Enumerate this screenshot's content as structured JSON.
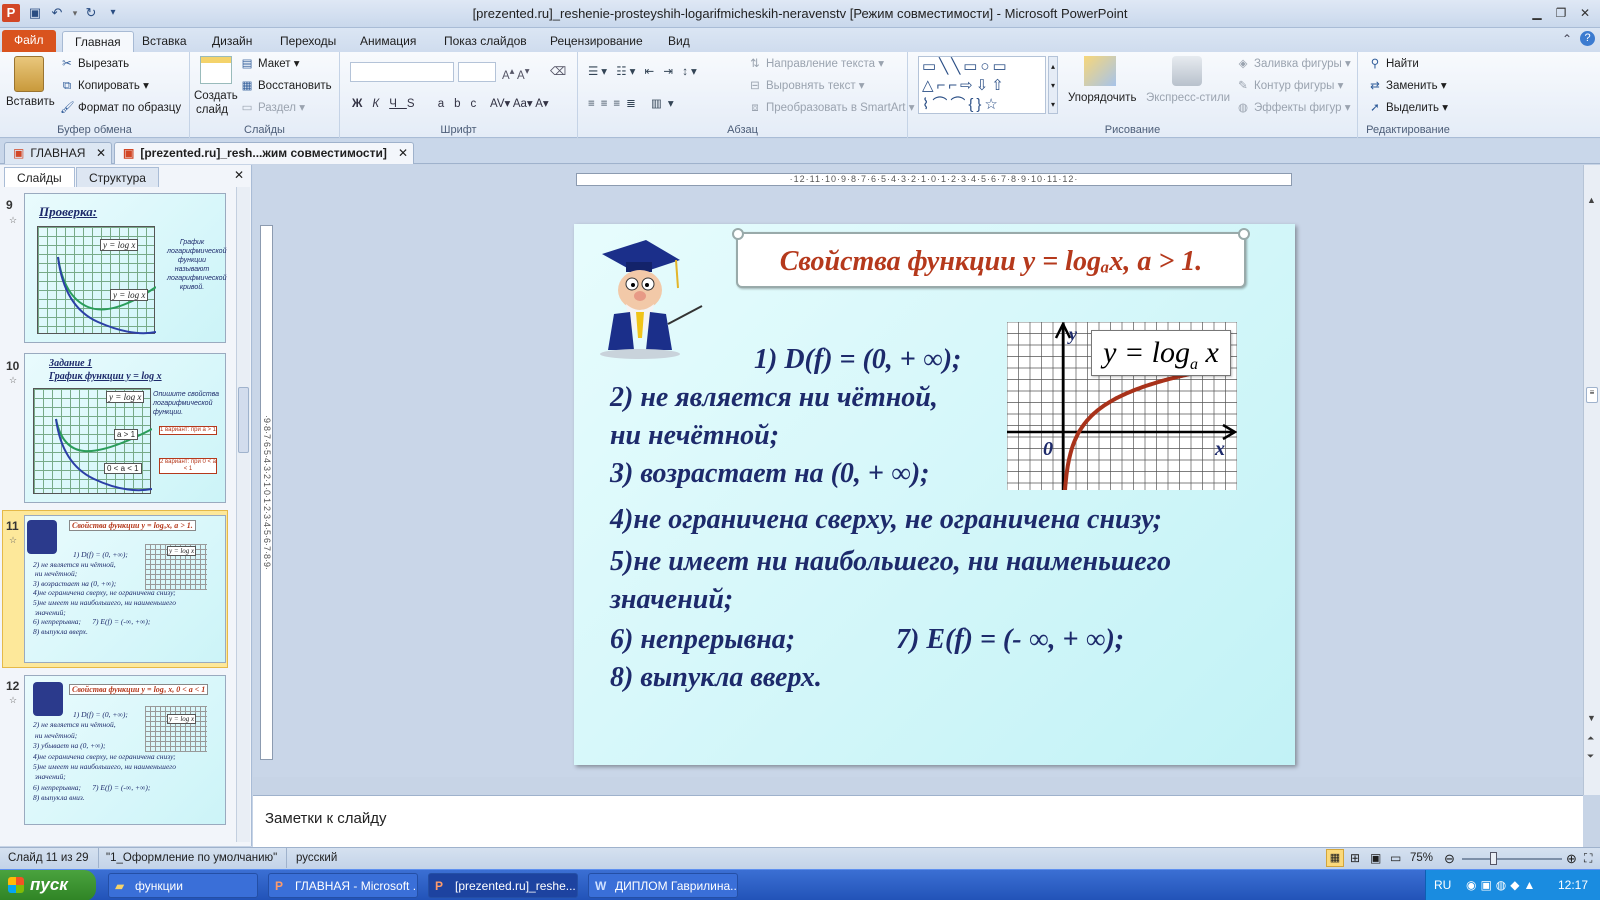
{
  "titlebar": {
    "title": "[prezented.ru]_reshenie-prosteyshih-logarifmicheskih-neravenstv [Режим совместимости]  -  Microsoft PowerPoint"
  },
  "ribbon_tabs": [
    "Файл",
    "Главная",
    "Вставка",
    "Дизайн",
    "Переходы",
    "Анимация",
    "Показ слайдов",
    "Рецензирование",
    "Вид"
  ],
  "clipboard": {
    "paste": "Вставить",
    "cut": "Вырезать",
    "copy": "Копировать",
    "format": "Формат по образцу",
    "label": "Буфер обмена"
  },
  "slides_group": {
    "new": "Создать",
    "new2": "слайд",
    "layout": "Макет",
    "reset": "Восстановить",
    "section": "Раздел",
    "label": "Слайды"
  },
  "font_group": {
    "label": "Шрифт"
  },
  "para_group": {
    "direction": "Направление текста",
    "align": "Выровнять текст",
    "smartart": "Преобразовать в SmartArt",
    "label": "Абзац"
  },
  "draw_group": {
    "arrange": "Упорядочить",
    "styles": "Экспресс-стили",
    "fill": "Заливка фигуры",
    "outline": "Контур фигуры",
    "effects": "Эффекты фигур",
    "label": "Рисование"
  },
  "edit_group": {
    "find": "Найти",
    "replace": "Заменить",
    "select": "Выделить",
    "label": "Редактирование"
  },
  "doctabs": [
    "ГЛАВНАЯ",
    "[prezented.ru]_resh...жим совместимости]"
  ],
  "pane_tabs": {
    "slides": "Слайды",
    "outline": "Структура"
  },
  "thumbs": {
    "s9": {
      "num": "9",
      "title": "Проверка:",
      "fn1": "y = log x",
      "fn2": "y = log x",
      "note": "График логарифмической функции называют логарифмической кривой."
    },
    "s10": {
      "num": "10",
      "title": "Задание 1",
      "sub": "График функции y = log x",
      "fn": "y = log x",
      "a1": "a > 1",
      "a2": "0 < a < 1",
      "note": "Опишите свойства логарифмической функции.",
      "v1": "1 вариант: при a > 1",
      "v2": "2 вариант: при 0 < a < 1"
    },
    "s11": {
      "num": "11",
      "title": "Свойства функции y = logₐx, a > 1.",
      "lines": [
        "1) D(f) = (0, +∞);",
        "2) не является ни чётной,",
        " ни нечётной;",
        "3) возрастает на (0, +∞);",
        "4)не ограничена сверху, не ограничена снизу;",
        "5)не имеет ни наибольшего, ни наименьшего",
        " значений;",
        "6) непрерывна;      7) E(f) = (-∞, +∞);",
        "8) выпукла вверх."
      ],
      "fn": "y = log x"
    },
    "s12": {
      "num": "12",
      "title": "Свойства функции y = logₐ x, 0 < a < 1",
      "lines": [
        "1) D(f) = (0, +∞);",
        "2) не является ни чётной,",
        " ни нечётной;",
        "3) убывает на (0, +∞);",
        "4)не ограничена сверху, не ограничена снизу;",
        "5)не имеет ни наибольшего, ни наименьшего",
        " значений;",
        "6) непрерывна;      7) E(f) = (-∞, +∞);",
        "8) выпукла вниз."
      ],
      "fn": "y = log x"
    }
  },
  "ruler_h": "·12·11·10·9·8·7·6·5·4·3·2·1·0·1·2·3·4·5·6·7·8·9·10·11·12·",
  "ruler_v": "·9·8·7·6·5·4·3·2·1·0·1·2·3·4·5·6·7·8·9·",
  "slide": {
    "title": "Свойства функции y = logₐx, a > 1.",
    "p1": "1) D(f) = (0, + ∞);",
    "p2a": "2) не является  ни чётной,",
    "p2b": " ни нечётной;",
    "p3": "3) возрастает на (0, + ∞);",
    "p4": "4)не ограничена сверху, не ограничена снизу;",
    "p5a": "5)не имеет ни наибольшего, ни наименьшего",
    "p5b": " значений;",
    "p6": "6) непрерывна;",
    "p7": "7) E(f) = (- ∞, + ∞);",
    "p8": "8) выпукла вверх.",
    "graph": {
      "label_y": "y",
      "label_x": "x",
      "label_0": "0",
      "fn_main": "y = log",
      "fn_sub": "a",
      "fn_var": " x"
    }
  },
  "notes_placeholder": "Заметки к слайду",
  "status": {
    "slide": "Слайд 11 из 29",
    "theme": "\"1_Оформление по умолчанию\"",
    "lang": "русский",
    "zoom": "75%"
  },
  "taskbar": {
    "start": "пуск",
    "tasks": [
      "функции",
      "ГЛАВНАЯ - Microsoft ...",
      "[prezented.ru]_reshe...",
      "ДИПЛОМ Гаврилина..."
    ],
    "lang": "RU",
    "time": "12:17"
  },
  "colors": {
    "accent_file": "#d9531e",
    "slide_title": "#b5391c",
    "slide_text": "#1d2a6b",
    "curve": "#a8321a"
  }
}
